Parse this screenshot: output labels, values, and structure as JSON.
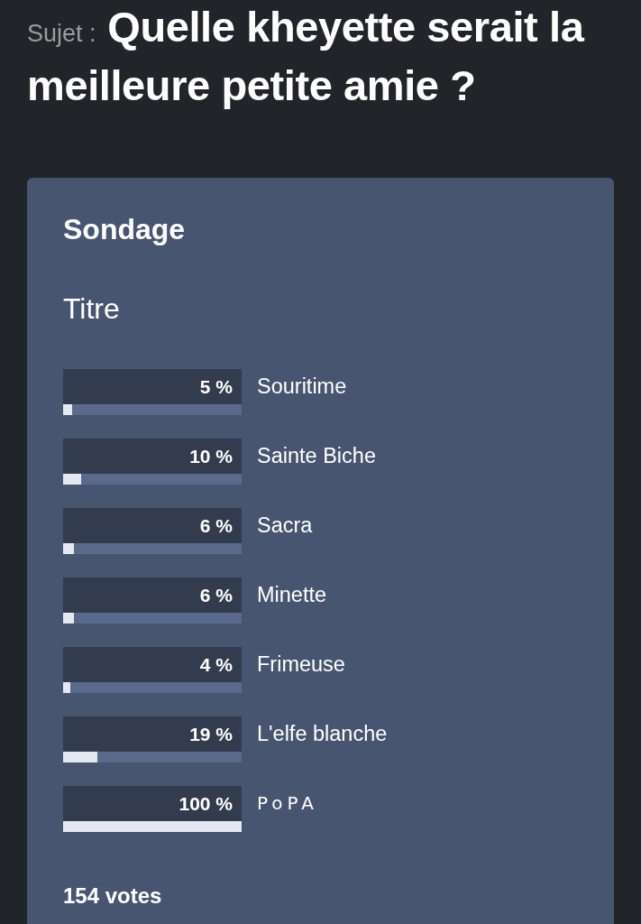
{
  "topic": {
    "prefix": "Sujet :",
    "title": "Quelle kheyette serait la meilleure petite amie ?"
  },
  "poll": {
    "heading": "Sondage",
    "question": "Titre",
    "options": [
      {
        "percent": "5 %",
        "label": "Souritime",
        "level": 0.05
      },
      {
        "percent": "10 %",
        "label": "Sainte Biche",
        "level": 0.1
      },
      {
        "percent": "6 %",
        "label": "Sacra",
        "level": 0.06
      },
      {
        "percent": "6 %",
        "label": "Minette",
        "level": 0.06
      },
      {
        "percent": "4 %",
        "label": "Frimeuse",
        "level": 0.04
      },
      {
        "percent": "19 %",
        "label": "L'elfe blanche",
        "level": 0.19
      },
      {
        "percent": "100 %",
        "label": "PoPA",
        "level": 1
      }
    ],
    "votes": "154 votes"
  }
}
